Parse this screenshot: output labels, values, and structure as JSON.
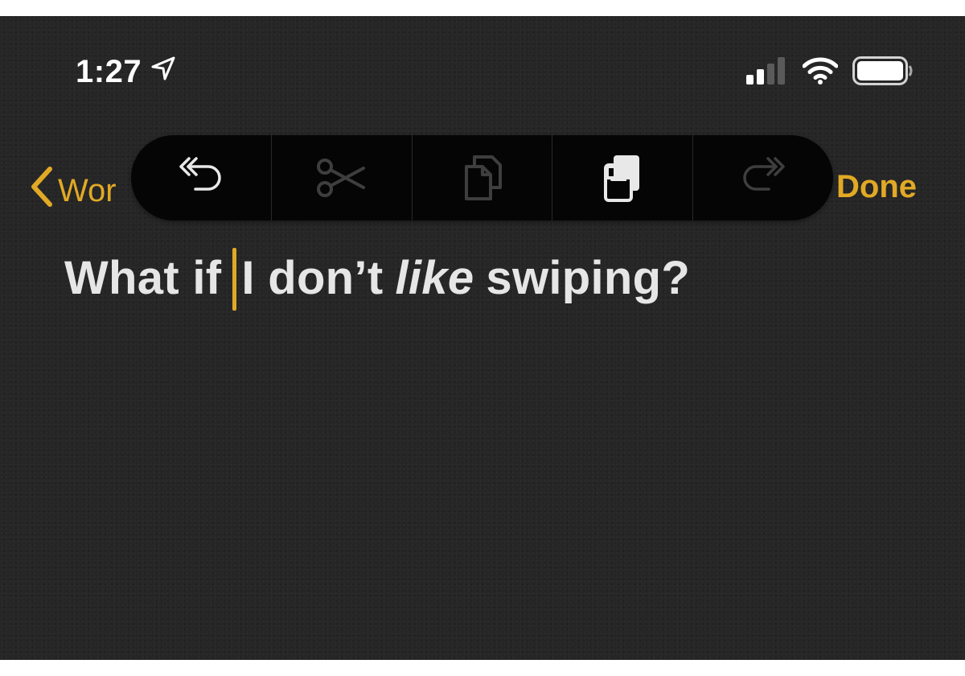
{
  "status_bar": {
    "time": "1:27",
    "location_icon": "location-arrow-icon",
    "signal_icon": "cellular-signal-icon",
    "wifi_icon": "wifi-icon",
    "battery_icon": "battery-icon"
  },
  "nav": {
    "back_label": "Wor",
    "done_label": "Done"
  },
  "edit_toolbar": {
    "buttons": [
      {
        "icon": "undo-icon",
        "enabled": true
      },
      {
        "icon": "cut-icon",
        "enabled": false
      },
      {
        "icon": "copy-icon",
        "enabled": false
      },
      {
        "icon": "paste-icon",
        "enabled": true
      },
      {
        "icon": "redo-icon",
        "enabled": false
      }
    ]
  },
  "note": {
    "text_before_caret": "What if",
    "text_after_caret_1": "I don’t",
    "text_italic": "like",
    "text_after_italic": "swiping?"
  },
  "colors": {
    "accent": "#e1a925",
    "background": "#262626",
    "toolbar": "#050505",
    "text": "#e6e6e6"
  }
}
